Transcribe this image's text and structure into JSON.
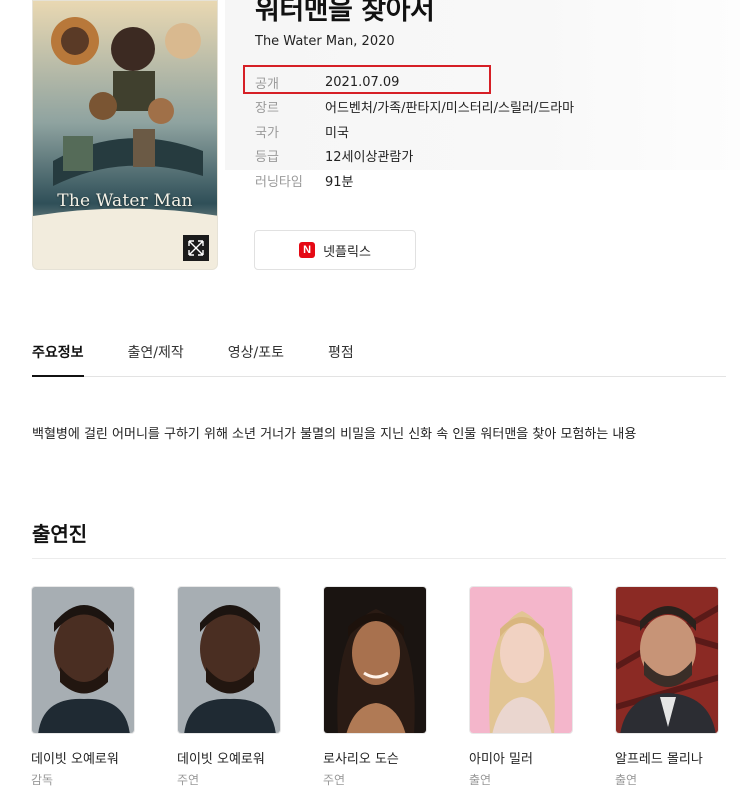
{
  "movie": {
    "title": "워터맨을 찾아서",
    "subtitle": "The Water Man, 2020",
    "poster_title": "The Water Man"
  },
  "info": [
    {
      "key": "공개",
      "value": "2021.07.09"
    },
    {
      "key": "장르",
      "value": "어드벤처/가족/판타지/미스터리/스릴러/드라마"
    },
    {
      "key": "국가",
      "value": "미국"
    },
    {
      "key": "등급",
      "value": "12세이상관람가"
    },
    {
      "key": "러닝타임",
      "value": "91분"
    }
  ],
  "streaming": {
    "label": "넷플릭스",
    "badge": "N",
    "badge_color": "#e50914"
  },
  "tabs": [
    {
      "label": "주요정보",
      "active": true
    },
    {
      "label": "출연/제작",
      "active": false
    },
    {
      "label": "영상/포토",
      "active": false
    },
    {
      "label": "평점",
      "active": false
    }
  ],
  "synopsis": "백혈병에 걸린 어머니를 구하기 위해 소년 거너가 불멸의 비밀을 지닌 신화 속 인물 워터맨을 찾아 모험하는 내용",
  "cast_heading": "출연진",
  "cast": [
    {
      "name": "데이빗 오예로워",
      "role": "감독"
    },
    {
      "name": "데이빗 오예로워",
      "role": "주연"
    },
    {
      "name": "로사리오 도슨",
      "role": "주연"
    },
    {
      "name": "아미아 밀러",
      "role": "출연"
    },
    {
      "name": "알프레드 몰리나",
      "role": "출연"
    }
  ],
  "icons": {
    "expand": "expand-icon",
    "netflix": "netflix-icon"
  },
  "colors": {
    "highlight": "#d61f26",
    "accent": "#111111"
  }
}
